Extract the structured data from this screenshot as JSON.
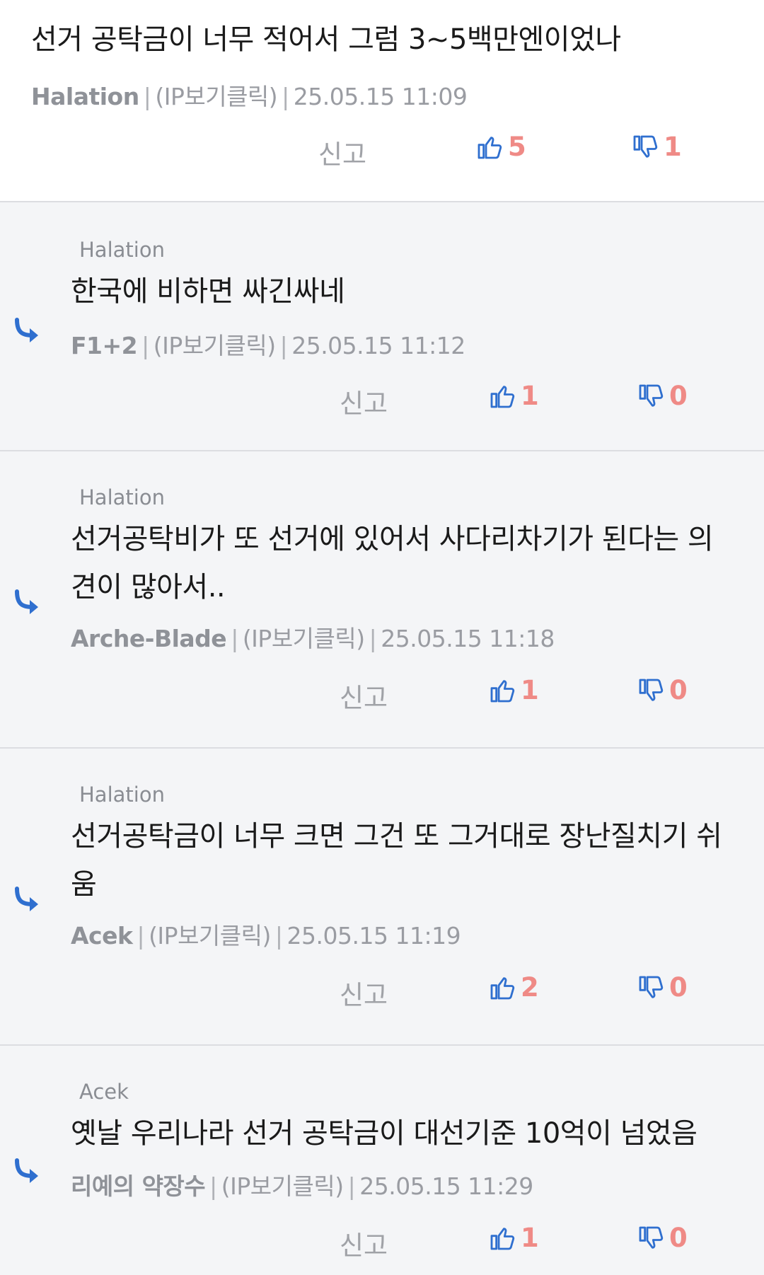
{
  "labels": {
    "report": "신고",
    "ip_link": "(IP보기클릭)",
    "separator": "|"
  },
  "colors": {
    "accent_blue": "#2f6fcf",
    "vote_red": "#ef8a86",
    "reply_bg": "#f4f5f7"
  },
  "icons": {
    "like": "thumbs-up-icon",
    "dislike": "thumbs-down-icon",
    "reply": "reply-arrow-icon"
  },
  "comments": [
    {
      "text": "선거 공탁금이 너무 적어서 그럼 3~5백만엔이었나",
      "author": "Halation",
      "datetime": "25.05.15 11:09",
      "up": "5",
      "down": "1"
    },
    {
      "parent_author": "Halation",
      "text": "한국에 비하면 싸긴싸네",
      "author": "F1+2",
      "datetime": "25.05.15 11:12",
      "up": "1",
      "down": "0"
    },
    {
      "parent_author": "Halation",
      "text": "선거공탁비가 또 선거에 있어서 사다리차기가 된다는 의견이 많아서..",
      "author": "Arche-Blade",
      "datetime": "25.05.15 11:18",
      "up": "1",
      "down": "0"
    },
    {
      "parent_author": "Halation",
      "text": "선거공탁금이 너무 크면 그건 또 그거대로 장난질치기 쉬움",
      "author": "Acek",
      "datetime": "25.05.15 11:19",
      "up": "2",
      "down": "0"
    },
    {
      "parent_author": "Acek",
      "text": "옛날 우리나라 선거 공탁금이 대선기준 10억이 넘었음",
      "author": "리예의 약장수",
      "datetime": "25.05.15 11:29",
      "up": "1",
      "down": "0"
    }
  ]
}
